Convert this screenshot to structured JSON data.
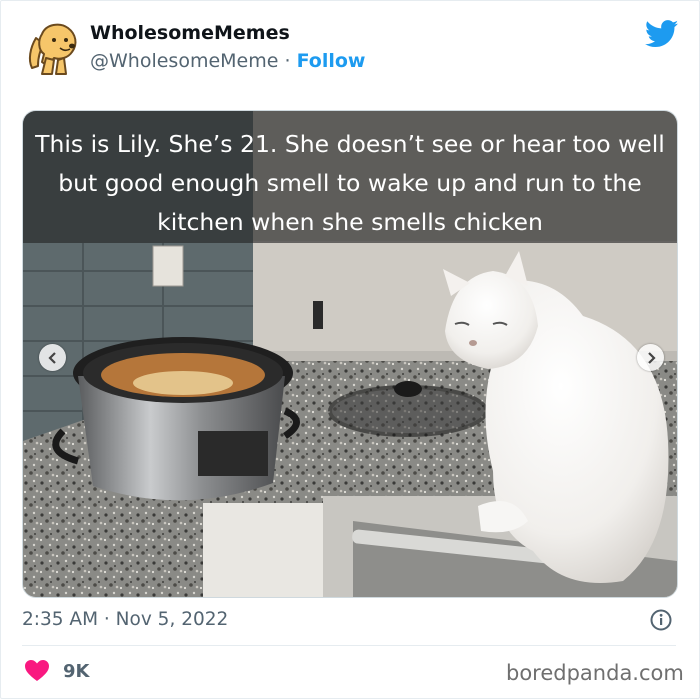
{
  "tweet": {
    "display_name": "WholesomeMemes",
    "handle": "@WholesomeMeme",
    "separator": "·",
    "follow_label": "Follow",
    "caption": "This is Lily. She’s 21. She doesn’t see or hear too well but good enough smell to wake up and run to the kitchen when she smells chicken",
    "timestamp": "2:35 AM · Nov 5, 2022",
    "likes": "9K"
  },
  "watermark": "boredpanda.com",
  "colors": {
    "brand": "#1d9bf0",
    "heart": "#f91880",
    "secondary_text": "#536471"
  },
  "icons": [
    "dog-avatar-icon",
    "twitter-bird-icon",
    "chevron-left-icon",
    "chevron-right-icon",
    "info-icon",
    "heart-icon"
  ]
}
